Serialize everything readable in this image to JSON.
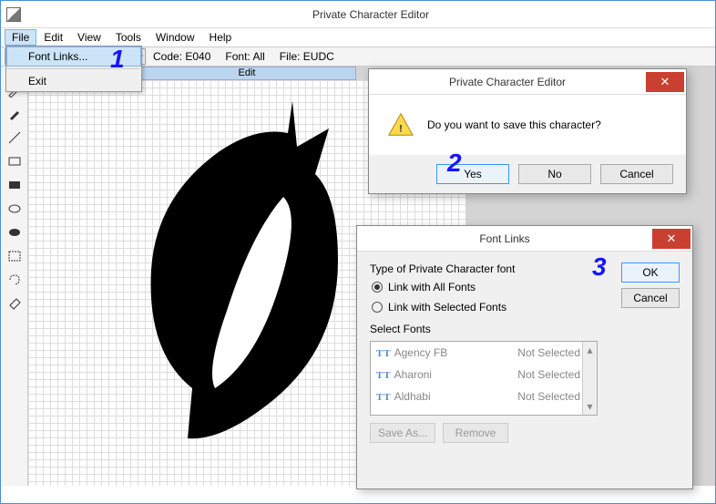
{
  "app": {
    "title": "Private Character Editor"
  },
  "menu": {
    "file": "File",
    "edit": "Edit",
    "view": "View",
    "tools": "Tools",
    "window": "Window",
    "help": "Help"
  },
  "file_menu": {
    "font_links": "Font Links...",
    "exit": "Exit"
  },
  "toolbar": {
    "code_label": "Code:",
    "code_value": "E040",
    "font_label": "Font:",
    "font_value": "All",
    "file_label": "File:",
    "file_value": "EUDC"
  },
  "edit_tab": "Edit",
  "annotations": {
    "one": "1",
    "two": "2",
    "three": "3"
  },
  "save_dialog": {
    "title": "Private Character Editor",
    "message": "Do you want to save this character?",
    "yes": "Yes",
    "no": "No",
    "cancel": "Cancel"
  },
  "fontlinks_dialog": {
    "title": "Font Links",
    "type_label": "Type of Private Character font",
    "opt_all": "Link with All Fonts",
    "opt_sel": "Link with Selected Fonts",
    "select_label": "Select Fonts",
    "ok": "OK",
    "cancel": "Cancel",
    "save_as": "Save As...",
    "remove": "Remove",
    "fonts": [
      {
        "name": "Agency FB",
        "state": "Not Selected"
      },
      {
        "name": "Aharoni",
        "state": "Not Selected"
      },
      {
        "name": "Aldhabi",
        "state": "Not Selected"
      }
    ]
  }
}
